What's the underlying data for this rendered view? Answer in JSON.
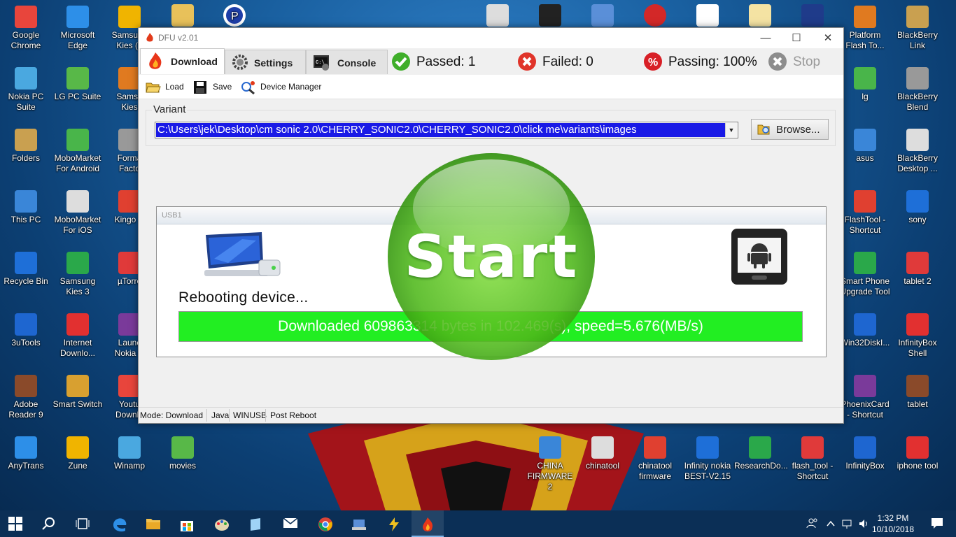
{
  "window": {
    "title": "DFU v2.01",
    "controls": {
      "minimize": "—",
      "maximize": "☐",
      "close": "✕"
    }
  },
  "tabs": [
    {
      "label": "Download",
      "icon": "flame-icon",
      "active": true
    },
    {
      "label": "Settings",
      "icon": "gear-icon",
      "active": false
    },
    {
      "label": "Console",
      "icon": "console-icon",
      "active": false
    }
  ],
  "stats": {
    "passed": "Passed: 1",
    "failed": "Failed: 0",
    "passing": "Passing: 100%",
    "stop": "Stop"
  },
  "toolbar": {
    "load": "Load",
    "save": "Save",
    "device_manager": "Device Manager"
  },
  "variant": {
    "label": "Variant",
    "value": "C:\\Users\\jek\\Desktop\\cm sonic 2.0\\CHERRY_SONIC2.0\\CHERRY_SONIC2.0\\click me\\variants\\images",
    "browse": "Browse..."
  },
  "usb": {
    "title": "USB1",
    "status": "Rebooting device...",
    "progress_text": "Downloaded 609863314 bytes in 102.469(s), speed=5.676(MB/s)",
    "progress_fraction": 1.0
  },
  "start_button": "Start",
  "statusbar": [
    "Mode: Download",
    "Java",
    "WINUSB",
    "Post Reboot"
  ],
  "desktop_icons_left": [
    [
      "Google",
      "Chrome"
    ],
    [
      "Microsoft",
      "Edge"
    ],
    [
      "Samsung",
      "Kies (L"
    ],
    [
      "Nokia PC",
      "Suite"
    ],
    [
      "LG PC Suite",
      ""
    ],
    [
      "Samsu",
      "Kies"
    ],
    [
      "Folders",
      ""
    ],
    [
      "MoboMarket",
      "For Android"
    ],
    [
      "Forma",
      "Facto"
    ],
    [
      "This PC",
      ""
    ],
    [
      "MoboMarket",
      "For iOS"
    ],
    [
      "Kingo R",
      ""
    ],
    [
      "Recycle Bin",
      ""
    ],
    [
      "Samsung",
      "Kies 3"
    ],
    [
      "µTorre",
      ""
    ],
    [
      "3uTools",
      ""
    ],
    [
      "Internet",
      "Downlo..."
    ],
    [
      "Launc",
      "Nokia C"
    ],
    [
      "Adobe",
      "Reader 9"
    ],
    [
      "Smart Switch",
      ""
    ],
    [
      "Youtu",
      "Downlo"
    ],
    [
      "AnyTrans",
      ""
    ],
    [
      "Zune",
      ""
    ],
    [
      "Winamp",
      ""
    ],
    [
      "movies",
      ""
    ]
  ],
  "desktop_icons_right": [
    [
      "Platform",
      "Flash To..."
    ],
    [
      "BlackBerry",
      "Link"
    ],
    [
      "lg",
      ""
    ],
    [
      "BlackBerry",
      "Blend"
    ],
    [
      "asus",
      ""
    ],
    [
      "BlackBerry",
      "Desktop ..."
    ],
    [
      "FlashTool -",
      "Shortcut"
    ],
    [
      "sony",
      ""
    ],
    [
      "Smart Phone",
      "Upgrade Tool"
    ],
    [
      "tablet 2",
      ""
    ],
    [
      "Win32DiskI...",
      ""
    ],
    [
      "InfinityBox",
      "Shell"
    ],
    [
      "PhoenixCard",
      "- Shortcut"
    ],
    [
      "tablet",
      ""
    ]
  ],
  "desktop_icons_bottom": [
    [
      "CHINA",
      "FIRMWARE 2"
    ],
    [
      "chinatool",
      ""
    ],
    [
      "chinatool",
      "firmware"
    ],
    [
      "Infinity nokia",
      "BEST-V2.15"
    ],
    [
      "ResearchDo...",
      ""
    ],
    [
      "flash_tool -",
      "Shortcut"
    ],
    [
      "InfinityBox",
      ""
    ],
    [
      "iphone tool",
      ""
    ]
  ],
  "taskbar": {
    "time": "1:32 PM",
    "date": "10/10/2018"
  },
  "colors": {
    "accent": "#1a1ae6",
    "progress": "#22ee22",
    "start": "#5cc41e"
  }
}
